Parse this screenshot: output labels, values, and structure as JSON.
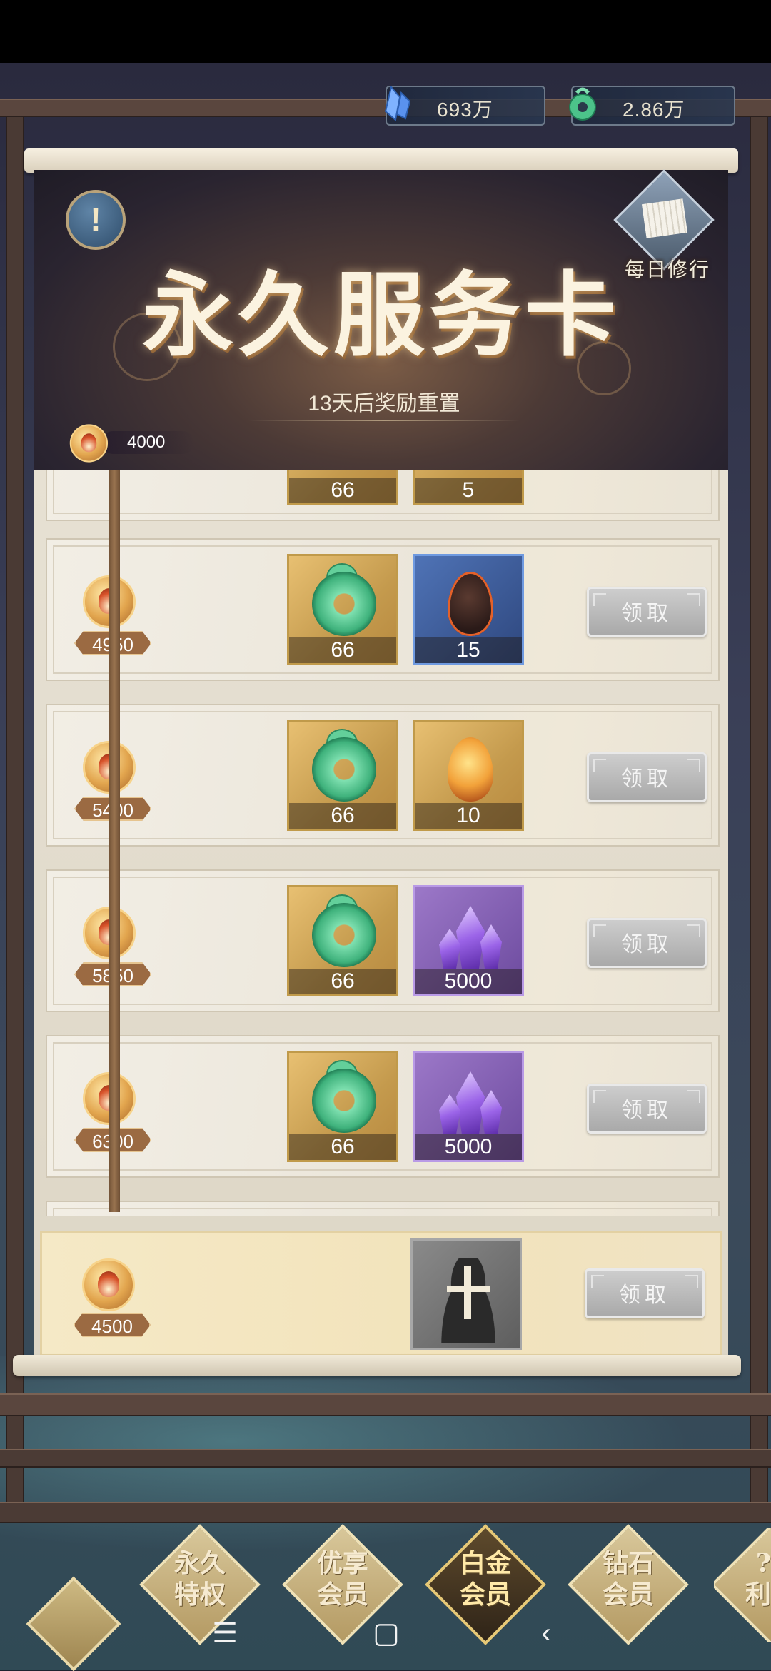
{
  "currency": {
    "crystals": {
      "value": "693万",
      "icon": "blue-crystal-icon"
    },
    "jade": {
      "value": "2.86万",
      "icon": "jade-pendant-icon"
    }
  },
  "banner": {
    "title": "永久服务卡",
    "subtitle": "13天后奖励重置",
    "daily_label": "每日修行",
    "info_icon": "exclamation-icon",
    "info_label": "!",
    "current_score": "4000"
  },
  "rewards": {
    "partial_row": {
      "items": [
        {
          "qty": "66"
        },
        {
          "qty": "5"
        }
      ]
    },
    "rows": [
      {
        "score": "4950",
        "items": [
          {
            "type": "jade",
            "qty": "66"
          },
          {
            "type": "dark-egg",
            "qty": "15"
          }
        ],
        "claim": "领取"
      },
      {
        "score": "5400",
        "items": [
          {
            "type": "jade",
            "qty": "66"
          },
          {
            "type": "fire-egg",
            "qty": "10"
          }
        ],
        "claim": "领取"
      },
      {
        "score": "5850",
        "items": [
          {
            "type": "jade",
            "qty": "66"
          },
          {
            "type": "crystal",
            "qty": "5000"
          }
        ],
        "claim": "领取"
      },
      {
        "score": "6300",
        "items": [
          {
            "type": "jade",
            "qty": "66"
          },
          {
            "type": "crystal",
            "qty": "5000"
          }
        ],
        "claim": "领取"
      }
    ],
    "bonus": {
      "score": "4500",
      "item": "mystery-character-icon",
      "claim": "领取"
    }
  },
  "tabs": [
    {
      "label1": "永久",
      "label2": "特权",
      "active": false
    },
    {
      "label1": "优享",
      "label2": "会员",
      "active": false
    },
    {
      "label1": "白金",
      "label2": "会员",
      "active": true
    },
    {
      "label1": "钻石",
      "label2": "会员",
      "active": false
    },
    {
      "label1": "?",
      "label2": "利",
      "active": false
    }
  ],
  "navbar": {
    "menu": "☰",
    "home": "▢",
    "back": "‹"
  },
  "colors": {
    "accent_gold": "#c09a4a",
    "claim_disabled": "#a9a9a9",
    "banner_text": "#fbf3e0"
  }
}
